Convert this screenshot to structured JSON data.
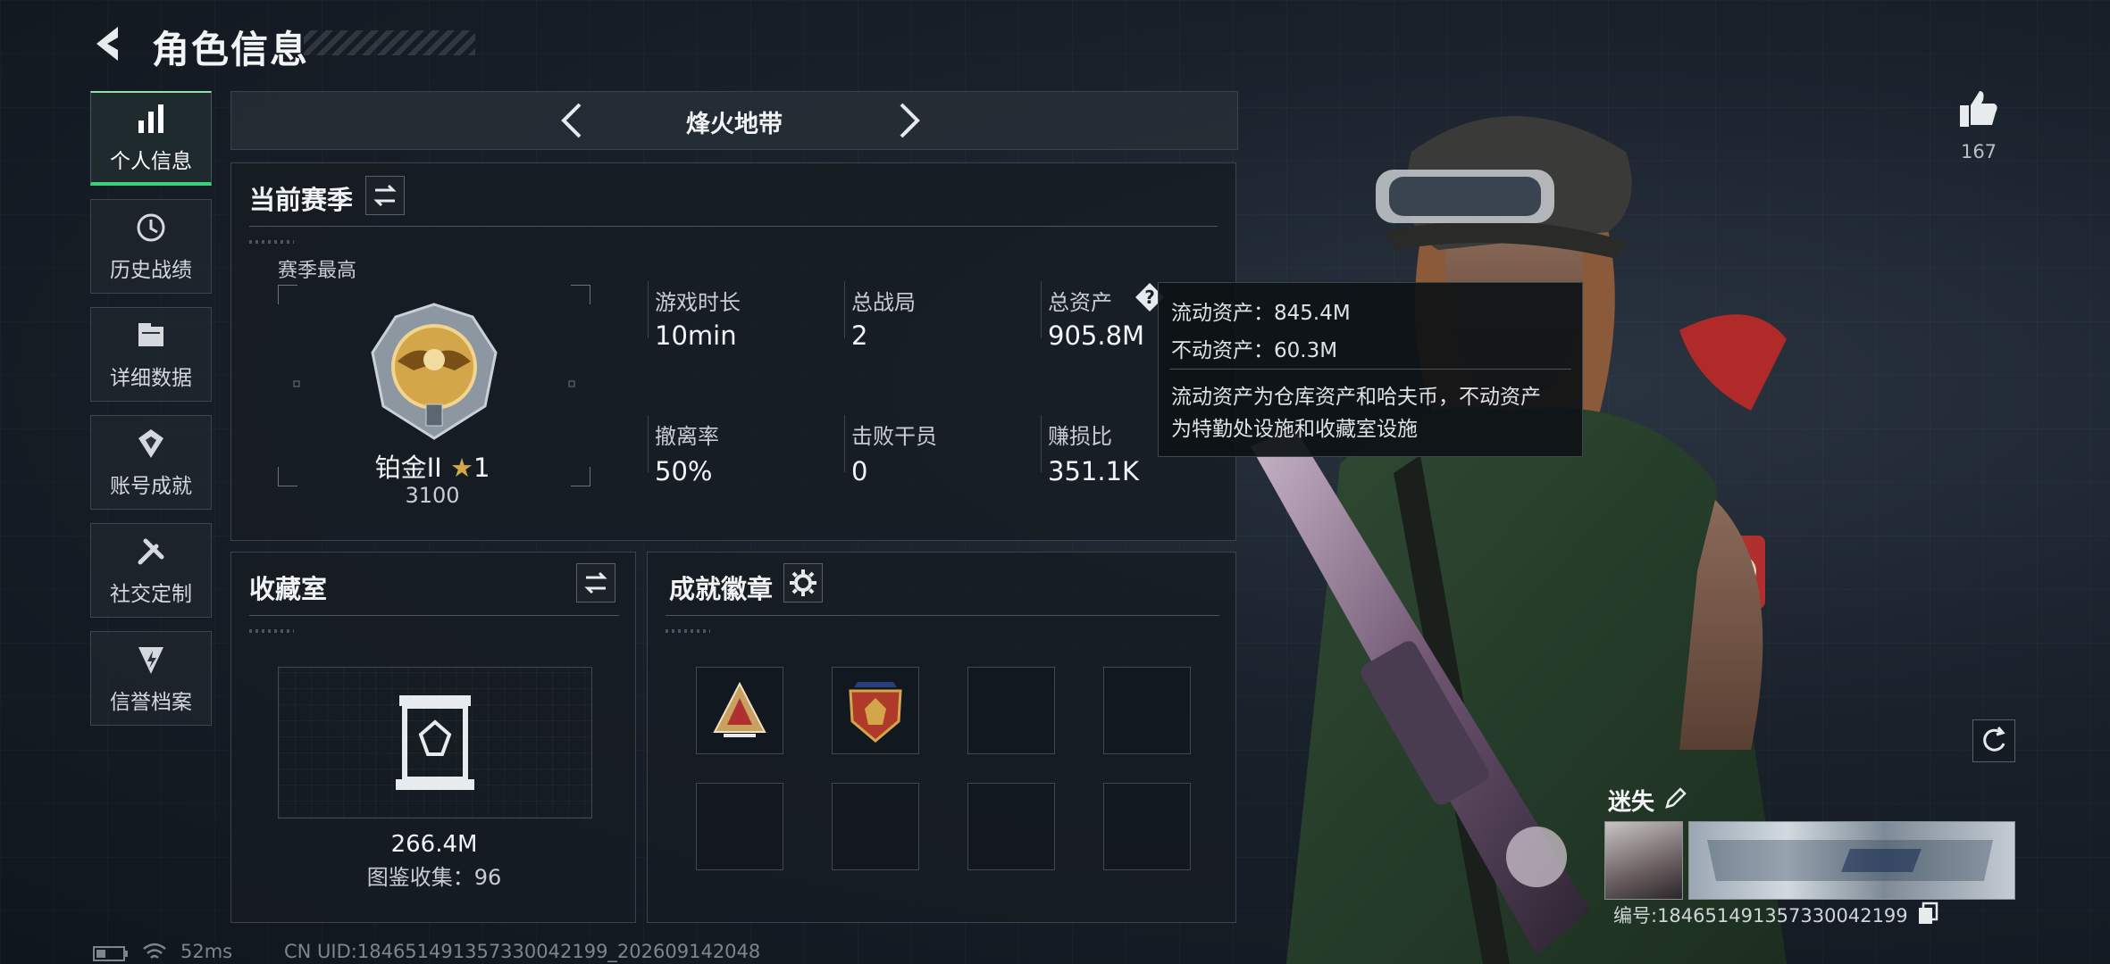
{
  "header": {
    "title": "角色信息"
  },
  "nav": {
    "items": [
      {
        "label": "个人信息",
        "icon": "bar-chart-icon",
        "active": true
      },
      {
        "label": "历史战绩",
        "icon": "clock-history-icon",
        "active": false
      },
      {
        "label": "详细数据",
        "icon": "folder-icon",
        "active": false
      },
      {
        "label": "账号成就",
        "icon": "achievement-icon",
        "active": false
      },
      {
        "label": "社交定制",
        "icon": "tools-icon",
        "active": false
      },
      {
        "label": "信誉档案",
        "icon": "credit-badge-icon",
        "active": false
      }
    ]
  },
  "mode": {
    "title": "烽火地带"
  },
  "season": {
    "title": "当前赛季",
    "best_label": "赛季最高",
    "rank_name": "铂金II",
    "rank_stars": "1",
    "rank_points": "3100",
    "stats": [
      {
        "label": "游戏时长",
        "value": "10min"
      },
      {
        "label": "总战局",
        "value": "2"
      },
      {
        "label": "总资产",
        "value": "905.8M"
      },
      {
        "label": "撤离率",
        "value": "50%"
      },
      {
        "label": "击败干员",
        "value": "0"
      },
      {
        "label": "赚损比",
        "value": "351.1K"
      }
    ]
  },
  "tooltip": {
    "liquid": "流动资产：845.4M",
    "fixed": "不动资产：60.3M",
    "desc_line1": "流动资产为仓库资产和哈夫币，不动资产",
    "desc_line2": "为特勤处设施和收藏室设施"
  },
  "collection": {
    "title": "收藏室",
    "value": "266.4M",
    "catalog": "图鉴收集：96"
  },
  "achievements": {
    "title": "成就徽章"
  },
  "profile": {
    "likes": "167",
    "name": "迷失",
    "id_text": "编号:1846514913573300421​99"
  },
  "status_bar": {
    "ping": "52ms",
    "uid": "CN UID:184651491357330042199_202609142048"
  },
  "colors": {
    "accent_green": "#3ad07a",
    "rank_gold": "#d4a64a"
  }
}
